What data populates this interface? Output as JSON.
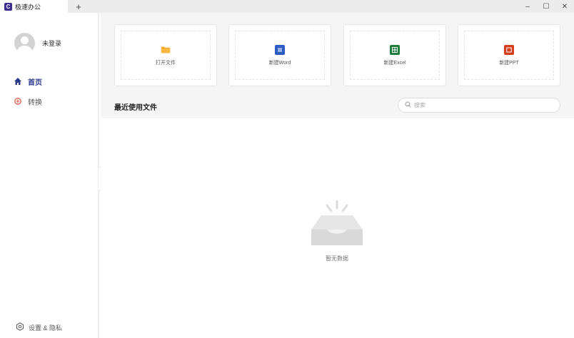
{
  "titlebar": {
    "tab_title": "极速办公",
    "app_logo_letter": "C",
    "new_tab_label": "+",
    "minimize_label": "–",
    "maximize_label": "☐",
    "close_label": "✕"
  },
  "sidebar": {
    "user_name": "未登录",
    "nav": [
      {
        "label": "首页",
        "icon": "home-icon",
        "active": true
      },
      {
        "label": "转换",
        "icon": "convert-icon",
        "active": false
      }
    ],
    "settings_label": "设置 & 隐私"
  },
  "cards": [
    {
      "label": "打开文件",
      "icon": "folder-icon",
      "color": "#f5a623"
    },
    {
      "label": "新建Word",
      "icon": "word-icon",
      "color": "#2b5cc6"
    },
    {
      "label": "新建Excel",
      "icon": "excel-icon",
      "color": "#1e7d3c"
    },
    {
      "label": "新建PPT",
      "icon": "ppt-icon",
      "color": "#d4401f"
    }
  ],
  "recent": {
    "title": "最近使用文件",
    "search_placeholder": "搜索",
    "empty_text": "暂无数据"
  },
  "colors": {
    "accent": "#2c3a8c",
    "convert": "#e05a4f"
  }
}
